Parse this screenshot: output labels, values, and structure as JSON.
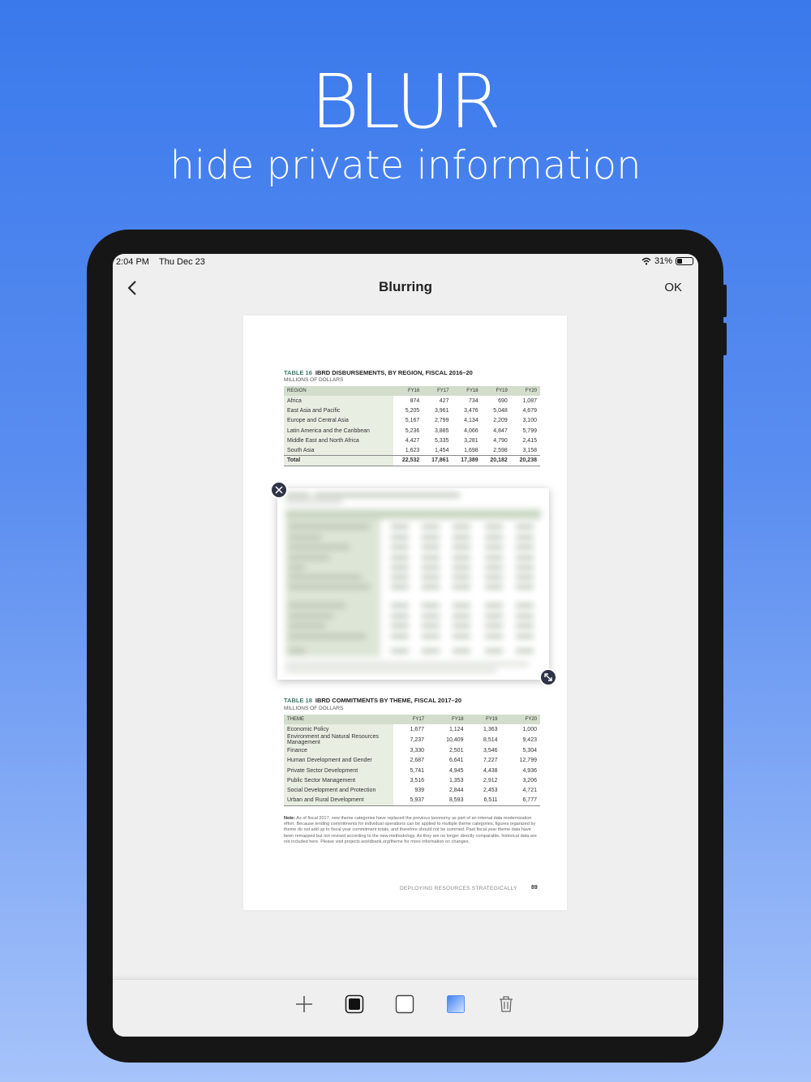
{
  "promo": {
    "title": "BLUR",
    "subtitle": "hide private information"
  },
  "statusbar": {
    "time": "2:04 PM",
    "date": "Thu Dec 23",
    "battery": "31%",
    "battery_level": 0.31
  },
  "navbar": {
    "title": "Blurring",
    "ok_label": "OK"
  },
  "document": {
    "table16": {
      "label": "TABLE 16",
      "title": "IBRD DISBURSEMENTS, BY REGION, FISCAL 2016–20",
      "subtitle": "MILLIONS OF DOLLARS",
      "headers": [
        "REGION",
        "FY16",
        "FY17",
        "FY18",
        "FY19",
        "FY20"
      ],
      "rows": [
        [
          "Africa",
          "874",
          "427",
          "734",
          "690",
          "1,087"
        ],
        [
          "East Asia and Pacific",
          "5,205",
          "3,961",
          "3,476",
          "5,048",
          "4,679"
        ],
        [
          "Europe and Central Asia",
          "5,167",
          "2,799",
          "4,134",
          "2,209",
          "3,100"
        ],
        [
          "Latin America and the Caribbean",
          "5,236",
          "3,885",
          "4,066",
          "4,847",
          "5,799"
        ],
        [
          "Middle East and North Africa",
          "4,427",
          "5,335",
          "3,281",
          "4,790",
          "2,415"
        ],
        [
          "South Asia",
          "1,623",
          "1,454",
          "1,698",
          "2,598",
          "3,158"
        ]
      ],
      "total": [
        "Total",
        "22,532",
        "17,861",
        "17,389",
        "20,182",
        "20,238"
      ]
    },
    "table18": {
      "label": "TABLE 18",
      "title": "IBRD COMMITMENTS BY THEME, FISCAL 2017–20",
      "subtitle": "MILLIONS OF DOLLARS",
      "headers": [
        "THEME",
        "FY17",
        "FY18",
        "FY19",
        "FY20"
      ],
      "rows": [
        [
          "Economic Policy",
          "1,677",
          "1,124",
          "1,363",
          "1,000"
        ],
        [
          "Environment and Natural Resources Management",
          "7,237",
          "10,409",
          "8,514",
          "9,423"
        ],
        [
          "Finance",
          "3,330",
          "2,501",
          "3,546",
          "5,304"
        ],
        [
          "Human Development and Gender",
          "2,687",
          "6,641",
          "7,227",
          "12,799"
        ],
        [
          "Private Sector Development",
          "5,741",
          "4,945",
          "4,438",
          "4,936"
        ],
        [
          "Public Sector Management",
          "3,516",
          "1,353",
          "2,912",
          "3,206"
        ],
        [
          "Social Development and Protection",
          "939",
          "2,844",
          "2,453",
          "4,721"
        ],
        [
          "Urban and Rural Development",
          "5,937",
          "8,593",
          "6,511",
          "6,777"
        ]
      ]
    },
    "note_label": "Note:",
    "note_text": "As of fiscal 2017, new theme categories have replaced the previous taxonomy as part of an internal data modernization effort. Because lending commitments for individual operations can be applied to multiple theme categories, figures organized by theme do not add up to fiscal year commitment totals, and therefore should not be summed. Past fiscal year theme data have been remapped but not revised according to the new methodology. As they are no longer directly comparable, historical data are not included here. Please visit projects.worldbank.org/theme for more information on changes.",
    "footer_text": "DEPLOYING RESOURCES STRATEGICALLY",
    "page_number": "89"
  },
  "icons": {
    "back": "chevron-left-icon",
    "remove": "close-icon",
    "resize": "resize-icon",
    "add": "plus-icon",
    "black": "black-square-icon",
    "white": "white-square-icon",
    "blur": "blur-square-icon",
    "delete": "trash-icon"
  },
  "colors": {
    "background_top": "#3a79ec",
    "background_bottom": "#a6c3fa",
    "handle": "#2f3447",
    "table_header": "#d3ddcc"
  }
}
